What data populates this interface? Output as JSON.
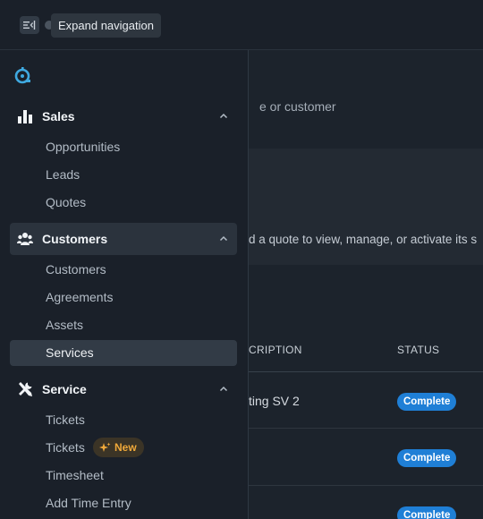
{
  "topbar": {
    "tooltip": "Expand navigation"
  },
  "main": {
    "search_hint": "e or customer",
    "instruction": "d a quote to view, manage, or activate its s",
    "table": {
      "headers": {
        "description": "CRIPTION",
        "status": "STATUS"
      },
      "rows": [
        {
          "description": "ting SV 2",
          "status": "Complete"
        },
        {
          "description": "",
          "status": "Complete"
        },
        {
          "description": "",
          "status": "Complete"
        }
      ]
    },
    "colors": {
      "badge": "#1f7fd6"
    }
  },
  "sidebar": {
    "logo": "app-logo-icon",
    "groups": [
      {
        "label": "Sales",
        "icon": "bar-chart-icon",
        "items": [
          {
            "label": "Opportunities"
          },
          {
            "label": "Leads"
          },
          {
            "label": "Quotes"
          }
        ]
      },
      {
        "label": "Customers",
        "icon": "people-icon",
        "items": [
          {
            "label": "Customers"
          },
          {
            "label": "Agreements"
          },
          {
            "label": "Assets"
          },
          {
            "label": "Services"
          }
        ]
      },
      {
        "label": "Service",
        "icon": "tools-icon",
        "items": [
          {
            "label": "Tickets"
          },
          {
            "label": "Tickets",
            "badge": "New"
          },
          {
            "label": "Timesheet"
          },
          {
            "label": "Add Time Entry"
          }
        ]
      }
    ],
    "colors": {
      "new_badge": "#f0a93a"
    }
  }
}
